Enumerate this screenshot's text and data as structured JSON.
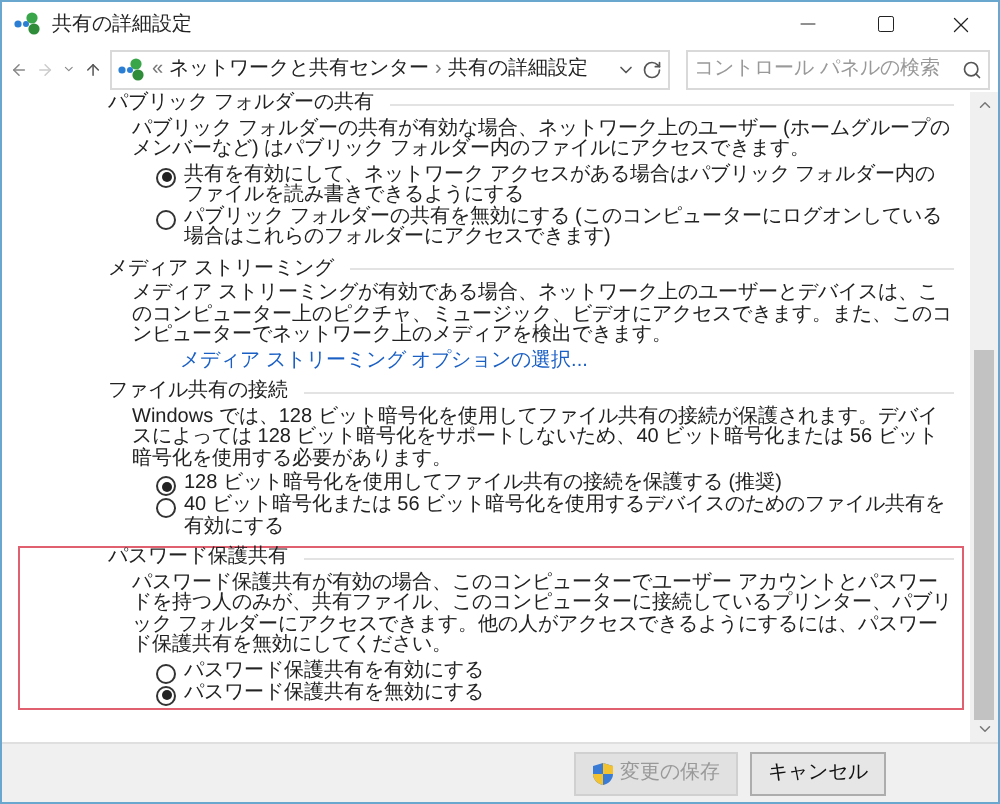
{
  "window": {
    "title": "共有の詳細設定"
  },
  "breadcrumb": {
    "prefix": "«",
    "items": [
      "ネットワークと共有センター",
      "共有の詳細設定"
    ],
    "separator": "›"
  },
  "search": {
    "placeholder": "コントロール パネルの検索"
  },
  "sections": [
    {
      "heading": "パブリック フォルダーの共有",
      "highlighted": false,
      "paragraph": "パブリック フォルダーの共有が有効な場合、ネットワーク上のユーザー (ホームグループのメンバーなど) はパブリック フォルダー内のファイルにアクセスできます。",
      "options": [
        {
          "label": "共有を有効にして、ネットワーク アクセスがある場合はパブリック フォルダー内のファイルを読み書きできるようにする",
          "selected": true
        },
        {
          "label": "パブリック フォルダーの共有を無効にする (このコンピューターにログオンしている場合はこれらのフォルダーにアクセスできます)",
          "selected": false
        }
      ]
    },
    {
      "heading": "メディア ストリーミング",
      "highlighted": false,
      "paragraph": "メディア ストリーミングが有効である場合、ネットワーク上のユーザーとデバイスは、このコンピューター上のピクチャ、ミュージック、ビデオにアクセスできます。また、このコンピューターでネットワーク上のメディアを検出できます。",
      "link": "メディア ストリーミング オプションの選択..."
    },
    {
      "heading": "ファイル共有の接続",
      "highlighted": false,
      "paragraph": "Windows では、128 ビット暗号化を使用してファイル共有の接続が保護されます。デバイスによっては 128 ビット暗号化をサポートしないため、40 ビット暗号化または 56 ビット暗号化を使用する必要があります。",
      "options": [
        {
          "label": "128 ビット暗号化を使用してファイル共有の接続を保護する (推奨)",
          "selected": true
        },
        {
          "label": "40 ビット暗号化または 56 ビット暗号化を使用するデバイスのためのファイル共有を有効にする",
          "selected": false
        }
      ]
    },
    {
      "heading": "パスワード保護共有",
      "highlighted": true,
      "paragraph": "パスワード保護共有が有効の場合、このコンピューターでユーザー アカウントとパスワードを持つ人のみが、共有ファイル、このコンピューターに接続しているプリンター、パブリック フォルダーにアクセスできます。他の人がアクセスできるようにするには、パスワード保護共有を無効にしてください。",
      "options": [
        {
          "label": "パスワード保護共有を有効にする",
          "selected": false
        },
        {
          "label": "パスワード保護共有を無効にする",
          "selected": true
        }
      ]
    }
  ],
  "buttons": [
    {
      "label": "変更の保存",
      "disabled": true,
      "kind": "shield"
    },
    {
      "label": "キャンセル",
      "disabled": false,
      "kind": "plain"
    }
  ]
}
